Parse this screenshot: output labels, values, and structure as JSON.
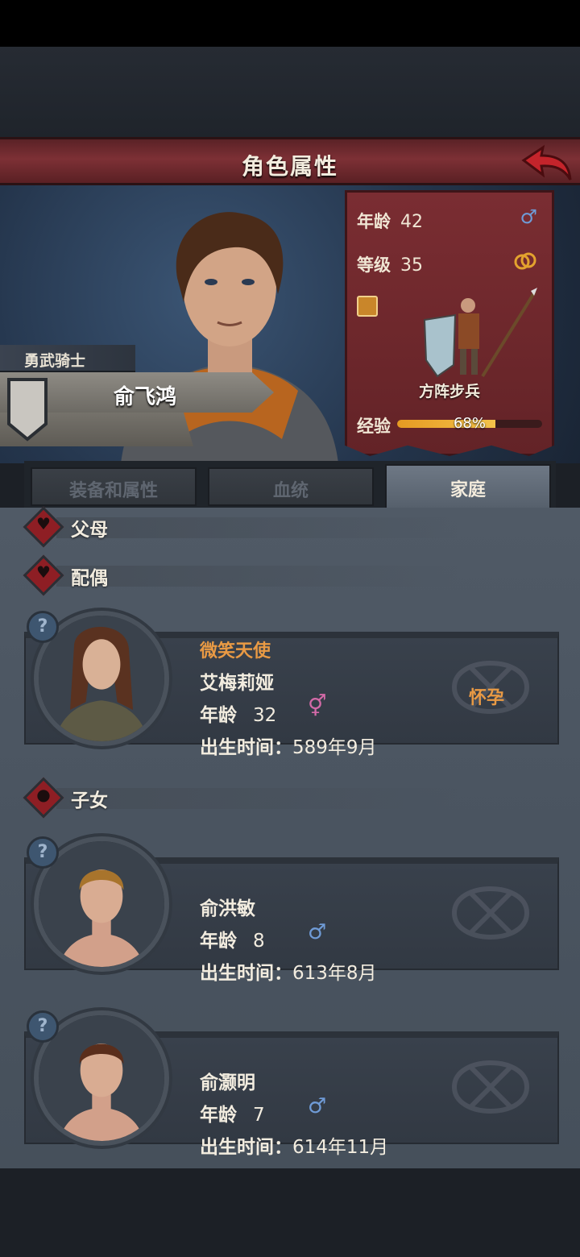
{
  "header": {
    "title": "角色属性"
  },
  "hero": {
    "rank_title": "勇武骑士",
    "name": "俞飞鸿"
  },
  "stats": {
    "age_label": "年龄",
    "age": "42",
    "gender_icon": "male-icon",
    "level_label": "等级",
    "level": "35",
    "married_icon": "rings-icon",
    "unit_name": "方阵步兵",
    "xp_label": "经验",
    "xp_percent": "68%",
    "xp_fraction": 0.68
  },
  "tabs": [
    {
      "label": "装备和属性",
      "active": false
    },
    {
      "label": "血统",
      "active": false
    },
    {
      "label": "家庭",
      "active": true
    }
  ],
  "family": {
    "parents_label": "父母",
    "spouse_label": "配偶",
    "children_label": "子女",
    "spouse": {
      "title": "微笑天使",
      "name": "艾梅莉娅",
      "age_label": "年龄",
      "age": "32",
      "gender": "female",
      "birth_label": "出生时间：",
      "birth": "589年9月",
      "status": "怀孕"
    },
    "children": [
      {
        "name": "俞洪敏",
        "age_label": "年龄",
        "age": "8",
        "gender": "male",
        "birth_label": "出生时间：",
        "birth": "613年8月"
      },
      {
        "name": "俞灏明",
        "age_label": "年龄",
        "age": "7",
        "gender": "male",
        "birth_label": "出生时间：",
        "birth": "614年11月"
      }
    ]
  },
  "colors": {
    "title_bar": "#7d3035",
    "accent_orange": "#e99a44",
    "male_blue": "#6f9bd6",
    "female_pink": "#d46aa8",
    "panel": "#4a5460"
  }
}
